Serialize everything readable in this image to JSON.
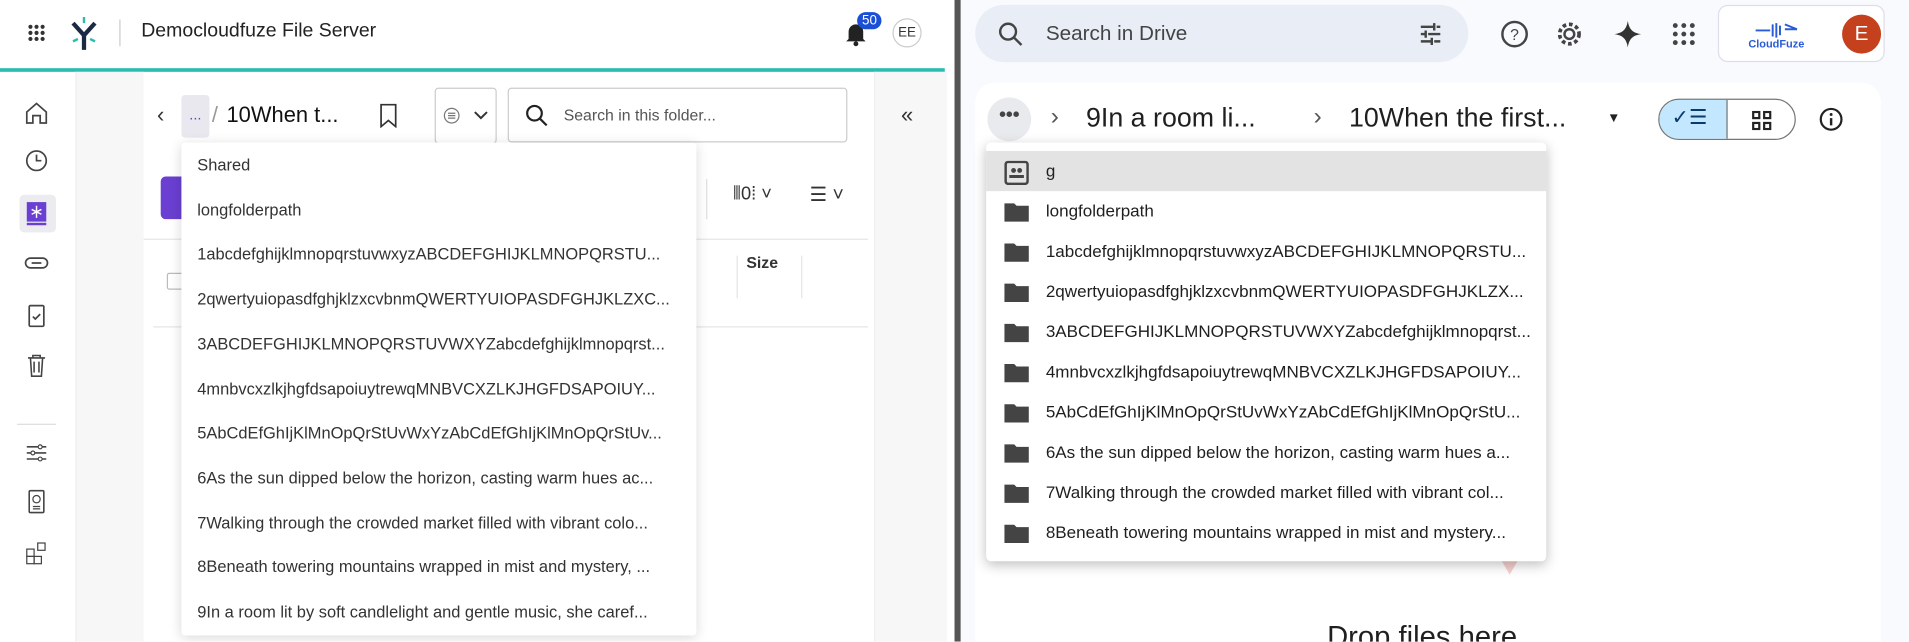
{
  "left_app": {
    "title": "Democloudfuze File Server",
    "notification_count": "50",
    "avatar": "EE",
    "breadcrumb": {
      "ellipsis": "...",
      "separator": "/",
      "current": "10When t..."
    },
    "search_placeholder": "Search in this folder...",
    "table": {
      "size_header": "Size"
    },
    "dropdown_items": [
      "Shared",
      "longfolderpath",
      "1abcdefghijklmnopqrstuvwxyzABCDEFGHIJKLMNOPQRSTU...",
      "2qwertyuiopasdfghjklzxcvbnmQWERTYUIOPASDFGHJKLZXC...",
      "3ABCDEFGHIJKLMNOPQRSTUVWXYZabcdefghijklmnopqrst...",
      "4mnbvcxzlkjhgfdsapoiuytrewqMNBVCXZLKJHGFDSAPOIUY...",
      "5AbCdEfGhIjKlMnOpQrStUvWxYzAbCdEfGhIjKlMnOpQrStUv...",
      "6As the sun dipped below the horizon, casting warm hues ac...",
      "7Walking through the crowded market filled with vibrant colo...",
      "8Beneath towering mountains wrapped in mist and mystery, ...",
      "9In a room lit by soft candlelight and gentle music, she caref..."
    ],
    "accent": "#2bbbb0",
    "brand_purple": "#6a3fd1"
  },
  "drive": {
    "search_placeholder": "Search in Drive",
    "logo_text": "CloudFuze",
    "avatar": "E",
    "breadcrumb": {
      "ellipsis": "•••",
      "parent": "9In a room li...",
      "current": "10When the first..."
    },
    "dropdown_items": [
      {
        "icon": "shared-drive",
        "label": "g"
      },
      {
        "icon": "folder",
        "label": "longfolderpath"
      },
      {
        "icon": "folder",
        "label": "1abcdefghijklmnopqrstuvwxyzABCDEFGHIJKLMNOPQRSTU..."
      },
      {
        "icon": "folder",
        "label": "2qwertyuiopasdfghjklzxcvbnmQWERTYUIOPASDFGHJKLZX..."
      },
      {
        "icon": "folder",
        "label": "3ABCDEFGHIJKLMNOPQRSTUVWXYZabcdefghijklmnopqrst..."
      },
      {
        "icon": "folder",
        "label": "4mnbvcxzlkjhgfdsapoiuytrewqMNBVCXZLKJHGFDSAPOIUY..."
      },
      {
        "icon": "folder",
        "label": "5AbCdEfGhIjKlMnOpQrStUvWxYzAbCdEfGhIjKlMnOpQrStU..."
      },
      {
        "icon": "folder",
        "label": "6As the sun dipped below the horizon, casting warm hues a..."
      },
      {
        "icon": "folder",
        "label": "7Walking through the crowded market filled with vibrant col..."
      },
      {
        "icon": "folder",
        "label": "8Beneath towering mountains wrapped in mist and mystery..."
      }
    ],
    "drop_text": "Drop files here",
    "avatar_color": "#c5401c",
    "toggle_color": "#c2e7ff"
  }
}
